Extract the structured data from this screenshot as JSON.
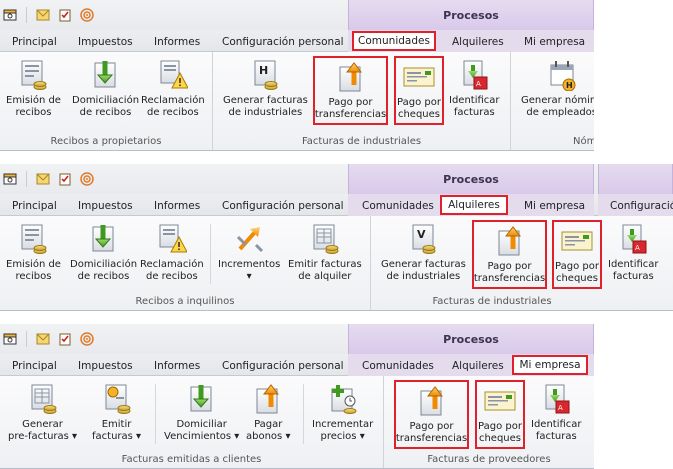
{
  "quick_access": [
    "app-icon",
    "mail-icon",
    "clipboard-check-icon",
    "rss-icon"
  ],
  "context_title": "Procesos",
  "panels": [
    {
      "tabs": [
        "Principal",
        "Impuestos",
        "Informes",
        "Configuración personal",
        "Comunidades",
        "Alquileres",
        "Mi empresa"
      ],
      "active_tab": "Comunidades",
      "groups": [
        {
          "label": "Recibos a propietarios",
          "buttons": [
            "Emisión de\nrecibos",
            "Domiciliación\nde recibos",
            "Reclamación\nde recibos"
          ]
        },
        {
          "label": "Facturas de industriales",
          "buttons": [
            "Generar facturas\nde industriales",
            "Pago por\ntransferencias",
            "Pago por\ncheques",
            "Identificar\nfacturas"
          ]
        },
        {
          "label": "Nómi",
          "buttons": [
            "Generar nómina\nde empleados"
          ]
        }
      ]
    },
    {
      "tabs": [
        "Principal",
        "Impuestos",
        "Informes",
        "Configuración personal",
        "Comunidades",
        "Alquileres",
        "Mi empresa",
        "Configuració"
      ],
      "active_tab": "Alquileres",
      "groups": [
        {
          "label": "Recibos a inquilinos",
          "buttons": [
            "Emisión de\nrecibos",
            "Domiciliación\nde recibos",
            "Reclamación\nde recibos",
            "Incrementos\n▾",
            "Emitir facturas\nde alquiler"
          ]
        },
        {
          "label": "Facturas de industriales",
          "buttons": [
            "Generar facturas\nde industriales",
            "Pago por\ntransferencias",
            "Pago por\ncheques",
            "Identificar\nfacturas"
          ]
        }
      ]
    },
    {
      "tabs": [
        "Principal",
        "Impuestos",
        "Informes",
        "Configuración personal",
        "Comunidades",
        "Alquileres",
        "Mi empresa"
      ],
      "active_tab": "Mi empresa",
      "groups": [
        {
          "label": "Facturas emitidas a clientes",
          "buttons": [
            "Generar\npre-facturas ▾",
            "Emitir\nfacturas ▾",
            "Domiciliar\nVencimientos ▾",
            "Pagar\nabonos ▾",
            "Incrementar\nprecios ▾"
          ]
        },
        {
          "label": "Facturas de proveedores",
          "buttons": [
            "Pago por\ntransferencias",
            "Pago por\ncheques",
            "Identificar\nfacturas"
          ]
        }
      ]
    }
  ]
}
